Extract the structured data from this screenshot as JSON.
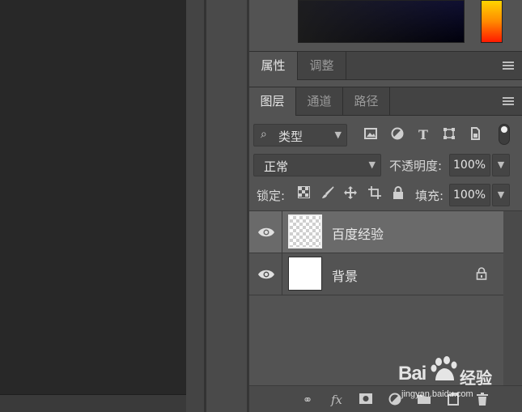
{
  "properties_tabs": [
    {
      "label": "属性",
      "active": true
    },
    {
      "label": "调整",
      "active": false
    }
  ],
  "layers_tabs": [
    {
      "label": "图层",
      "active": true
    },
    {
      "label": "通道",
      "active": false
    },
    {
      "label": "路径",
      "active": false
    }
  ],
  "filter": {
    "kind_label": "类型",
    "icons": [
      "image-filter-icon",
      "adjustment-filter-icon",
      "type-filter-icon",
      "shape-filter-icon",
      "smart-object-filter-icon",
      "filter-toggle-icon"
    ]
  },
  "blend": {
    "mode": "正常",
    "opacity_label": "不透明度:",
    "opacity_value": "100%"
  },
  "lock": {
    "label": "锁定:",
    "fill_label": "填充:",
    "fill_value": "100%"
  },
  "layers": [
    {
      "name": "百度经验",
      "selected": true,
      "thumb": "transparent",
      "locked": false
    },
    {
      "name": "背景",
      "selected": false,
      "thumb": "white",
      "locked": true
    }
  ],
  "watermark": {
    "brand": "Bai",
    "suffix": "经验",
    "url": "jingyan.baidu.com"
  },
  "colors": {
    "panel": "#535353",
    "canvas": "#282828",
    "selected_layer": "#6a6a6a"
  }
}
